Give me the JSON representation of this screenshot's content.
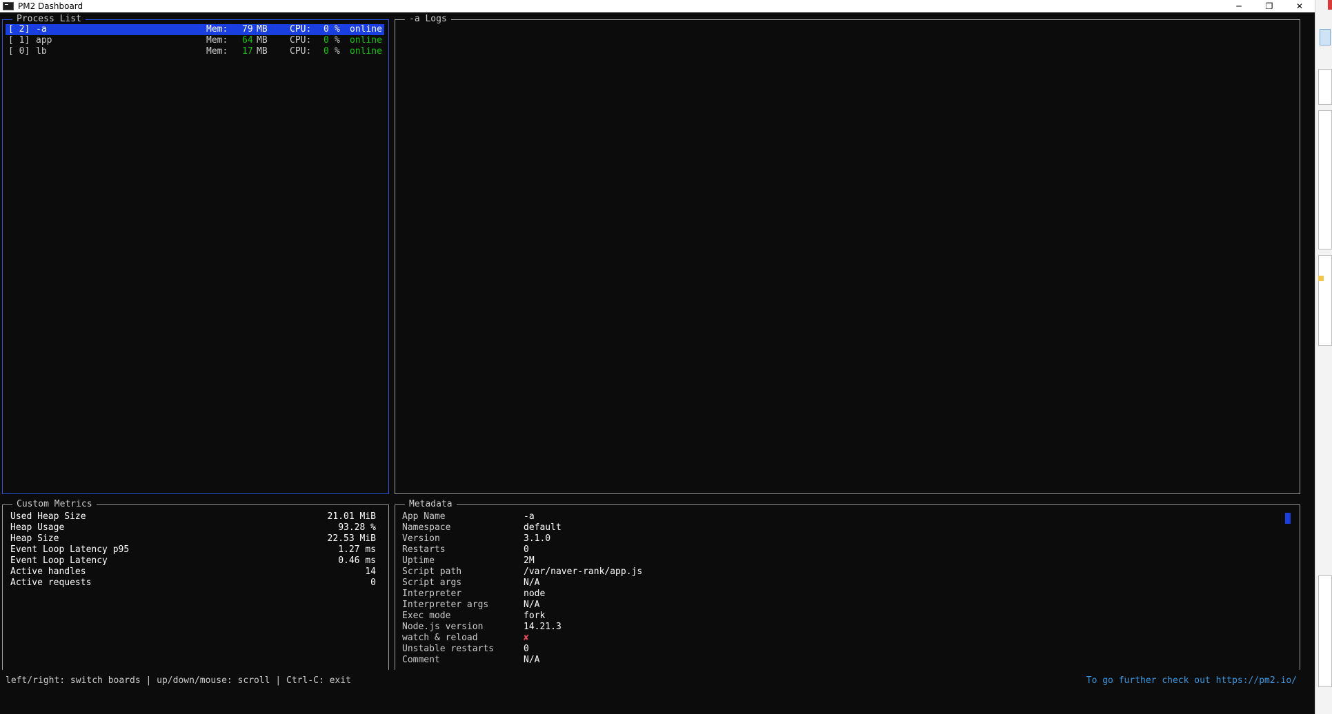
{
  "window": {
    "title": "PM2 Dashboard",
    "controls": {
      "minimize": "─",
      "restore": "❐",
      "close": "✕"
    }
  },
  "process_list": {
    "title": "Process List",
    "rows": [
      {
        "id": "[ 2]",
        "name": "-a",
        "mem_label": "Mem:",
        "mem_value": "79",
        "mem_unit": "MB",
        "cpu_label": "CPU:",
        "cpu_value": "0",
        "cpu_unit": "%",
        "status": "online",
        "selected": true
      },
      {
        "id": "[ 1]",
        "name": "app",
        "mem_label": "Mem:",
        "mem_value": "64",
        "mem_unit": "MB",
        "cpu_label": "CPU:",
        "cpu_value": "0",
        "cpu_unit": "%",
        "status": "online",
        "selected": false
      },
      {
        "id": "[ 0]",
        "name": "lb",
        "mem_label": "Mem:",
        "mem_value": "17",
        "mem_unit": "MB",
        "cpu_label": "CPU:",
        "cpu_value": "0",
        "cpu_unit": "%",
        "status": "online",
        "selected": false
      }
    ]
  },
  "logs": {
    "title": "-a Logs"
  },
  "custom_metrics": {
    "title": "Custom Metrics",
    "rows": [
      {
        "key": "Used Heap Size",
        "value": "21.01 MiB"
      },
      {
        "key": "Heap Usage",
        "value": "93.28 %"
      },
      {
        "key": "Heap Size",
        "value": "22.53 MiB"
      },
      {
        "key": "Event Loop Latency p95",
        "value": "1.27 ms"
      },
      {
        "key": "Event Loop Latency",
        "value": "0.46 ms"
      },
      {
        "key": "Active handles",
        "value": "14"
      },
      {
        "key": "Active requests",
        "value": "0"
      }
    ]
  },
  "metadata": {
    "title": "Metadata",
    "rows": [
      {
        "key": "App Name",
        "value": "-a"
      },
      {
        "key": "Namespace",
        "value": "default"
      },
      {
        "key": "Version",
        "value": "3.1.0"
      },
      {
        "key": "Restarts",
        "value": "0"
      },
      {
        "key": "Uptime",
        "value": "2M"
      },
      {
        "key": "Script path",
        "value": "/var/naver-rank/app.js"
      },
      {
        "key": "Script args",
        "value": "N/A"
      },
      {
        "key": "Interpreter",
        "value": "node"
      },
      {
        "key": "Interpreter args",
        "value": "N/A"
      },
      {
        "key": "Exec mode",
        "value": "fork"
      },
      {
        "key": "Node.js version",
        "value": "14.21.3"
      },
      {
        "key": "watch & reload",
        "value": "✘"
      },
      {
        "key": "Unstable restarts",
        "value": "0"
      },
      {
        "key": "Comment",
        "value": "N/A"
      }
    ]
  },
  "footer": {
    "help": "left/right: switch boards | up/down/mouse: scroll | Ctrl-C: exit",
    "link": "To go further check out https://pm2.io/"
  },
  "colors": {
    "background": "#0c0c0c",
    "selection": "#1a3fe0",
    "online": "#16c60c",
    "footer_link": "#3a96dd"
  }
}
